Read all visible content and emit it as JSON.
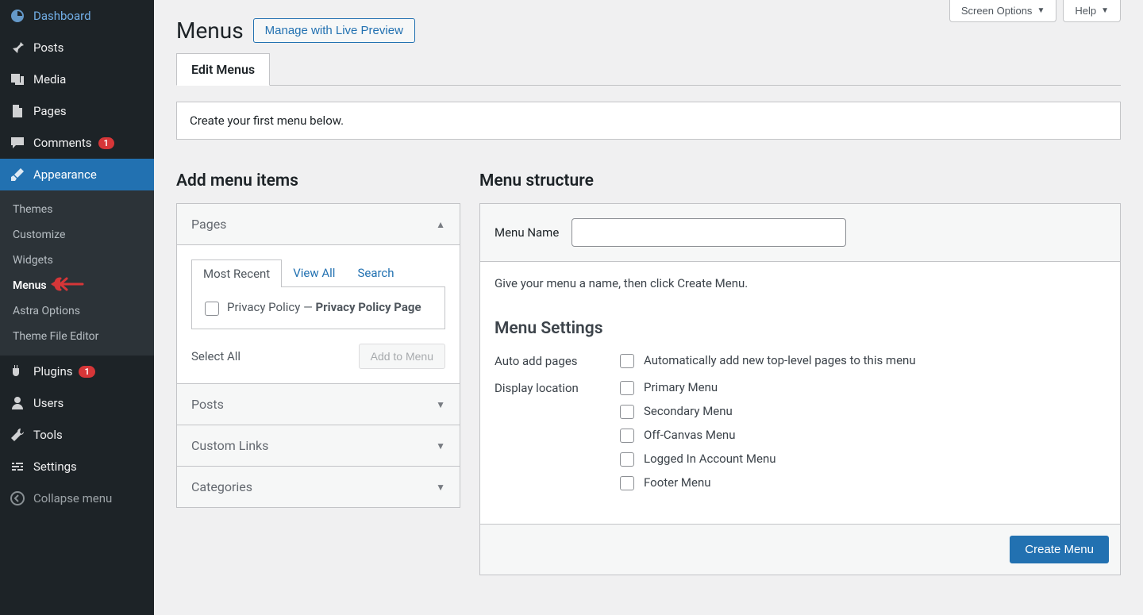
{
  "topRight": {
    "screenOptions": "Screen Options",
    "help": "Help"
  },
  "sidebar": {
    "dashboard": "Dashboard",
    "posts": "Posts",
    "media": "Media",
    "pages": "Pages",
    "comments": "Comments",
    "commentsBadge": "1",
    "appearance": "Appearance",
    "plugins": "Plugins",
    "pluginsBadge": "1",
    "users": "Users",
    "tools": "Tools",
    "settings": "Settings",
    "collapse": "Collapse menu",
    "submenu": {
      "themes": "Themes",
      "customize": "Customize",
      "widgets": "Widgets",
      "menus": "Menus",
      "astra": "Astra Options",
      "editor": "Theme File Editor"
    }
  },
  "page": {
    "title": "Menus",
    "livePreview": "Manage with Live Preview",
    "tab": "Edit Menus",
    "notice": "Create your first menu below."
  },
  "left": {
    "heading": "Add menu items",
    "pages": "Pages",
    "posts": "Posts",
    "custom": "Custom Links",
    "categories": "Categories",
    "tabs": {
      "recent": "Most Recent",
      "viewAll": "View All",
      "search": "Search"
    },
    "itemPrefix": "Privacy Policy — ",
    "itemBold": "Privacy Policy Page",
    "selectAll": "Select All",
    "addToMenu": "Add to Menu"
  },
  "right": {
    "heading": "Menu structure",
    "nameLabel": "Menu Name",
    "nameValue": "",
    "hint": "Give your menu a name, then click Create Menu.",
    "settingsHeading": "Menu Settings",
    "autoAddLabel": "Auto add pages",
    "autoAddOpt": "Automatically add new top-level pages to this menu",
    "displayLabel": "Display location",
    "locations": [
      "Primary Menu",
      "Secondary Menu",
      "Off-Canvas Menu",
      "Logged In Account Menu",
      "Footer Menu"
    ],
    "createBtn": "Create Menu"
  }
}
